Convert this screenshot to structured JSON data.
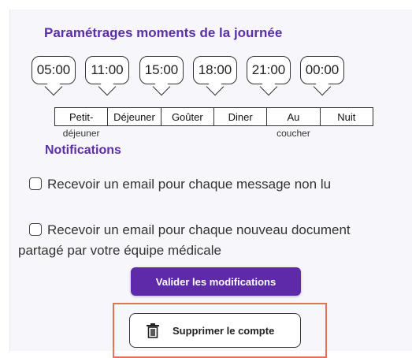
{
  "moments": {
    "title": "Paramétrages moments de la journée",
    "times": [
      "05:00",
      "11:00",
      "15:00",
      "18:00",
      "21:00",
      "00:00"
    ],
    "periods": [
      {
        "label": "Petit-",
        "sublabel": "déjeuner"
      },
      {
        "label": "Déjeuner",
        "sublabel": ""
      },
      {
        "label": "Goûter",
        "sublabel": ""
      },
      {
        "label": "Diner",
        "sublabel": ""
      },
      {
        "label": "Au",
        "sublabel": "coucher"
      },
      {
        "label": "Nuit",
        "sublabel": ""
      }
    ]
  },
  "notifications": {
    "title": "Notifications",
    "option1": {
      "label": "Recevoir un email pour chaque message non lu",
      "checked": false
    },
    "option2": {
      "label_line1": "Recevoir un email pour chaque nouveau document",
      "label_line2": "partagé par votre équipe médicale",
      "checked": false
    }
  },
  "actions": {
    "submit_label": "Valider les modifications",
    "delete_label": "Supprimer le compte",
    "delete_icon": "trash-icon"
  },
  "colors": {
    "accent": "#5e2aa9",
    "heading": "#5b2fa6",
    "highlight": "#e0735c"
  }
}
